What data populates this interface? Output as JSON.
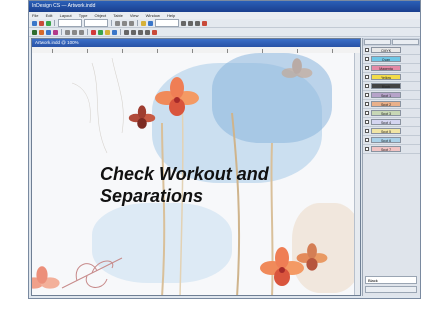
{
  "app": {
    "title": "InDesign CS — Artwork.indd",
    "menu": [
      "File",
      "Edit",
      "Layout",
      "Type",
      "Object",
      "Table",
      "View",
      "Window",
      "Help"
    ]
  },
  "document": {
    "title": "Artwork.indd @ 100%"
  },
  "headline": {
    "line1": "Check Workout and",
    "line2": "Separations"
  },
  "separations_panel": {
    "rows": [
      {
        "name": "CMYK",
        "color": "#e8e8e8"
      },
      {
        "name": "Cyan",
        "color": "#6fc7e6"
      },
      {
        "name": "Magenta",
        "color": "#e48aa6"
      },
      {
        "name": "Yellow",
        "color": "#f2dc4a"
      },
      {
        "name": "Black",
        "color": "#444444"
      },
      {
        "name": "Spot 1",
        "color": "#b6a3c9"
      },
      {
        "name": "Spot 2",
        "color": "#e9b08a"
      },
      {
        "name": "Spot 3",
        "color": "#c7d7b5"
      },
      {
        "name": "Spot 4",
        "color": "#d5d5f0"
      },
      {
        "name": "Spot 5",
        "color": "#f1e5a5"
      },
      {
        "name": "Spot 6",
        "color": "#a9d1e8"
      },
      {
        "name": "Spot 7",
        "color": "#f0c3c3"
      }
    ],
    "bottom_field": "Black"
  }
}
